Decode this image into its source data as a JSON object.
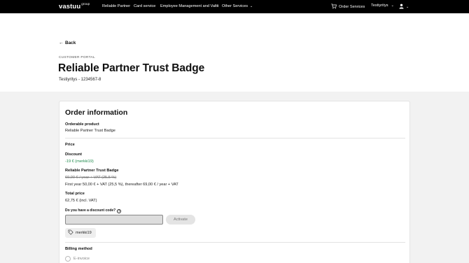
{
  "nav": {
    "logo": "vastuu",
    "logo_sup": "group",
    "items": [
      {
        "label": "Reliable Partner"
      },
      {
        "label": "Card service"
      },
      {
        "label": "Employee Management and Valtti"
      },
      {
        "label": "Other Services"
      }
    ],
    "order_services": "Order Services",
    "company_menu": "Testiyritys",
    "icons": {
      "cart": "cart-icon",
      "user": "user-icon",
      "chevron": "chevron-down-icon"
    }
  },
  "header": {
    "back": "Back",
    "eyebrow": "CUSTOMER PORTAL",
    "title": "Reliable Partner Trust Badge",
    "company": "Testiyritys - 1234567-8"
  },
  "order": {
    "title": "Order information",
    "product_label": "Orderable product",
    "product_value": "Reliable Partner Trust Badge",
    "price_label": "Price",
    "discount_label": "Discount",
    "discount_value": "-19 € (merkki19)",
    "badge_label": "Reliable Partner Trust Badge",
    "original_price": "69,00 € / year + VAT (25,5 %)",
    "new_price": "First year 50,00 € + VAT (25,5 %), thereafter 69,00 € / year + VAT",
    "total_label": "Total price",
    "total_value": "62,75 € (incl. VAT)",
    "discount_question": "Do you have a discount code?",
    "discount_input_value": "",
    "activate": "Activate",
    "applied_code": "merkki19",
    "billing_label": "Billing method",
    "billing_option": "E-invoice"
  },
  "colors": {
    "topbar": "#000000",
    "discount": "#1f8a4c"
  }
}
